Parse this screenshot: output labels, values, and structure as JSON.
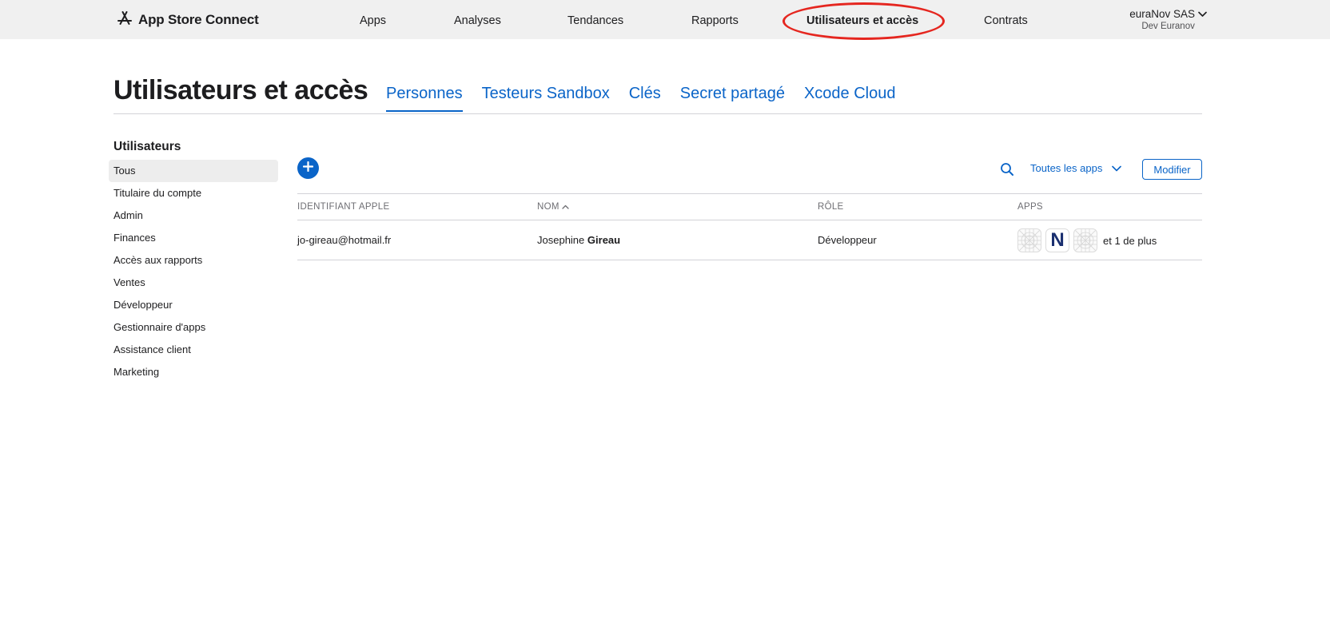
{
  "topbar": {
    "brand": "App Store Connect",
    "nav": [
      {
        "label": "Apps"
      },
      {
        "label": "Analyses"
      },
      {
        "label": "Tendances"
      },
      {
        "label": "Rapports"
      },
      {
        "label": "Utilisateurs et accès",
        "active": true
      },
      {
        "label": "Contrats"
      }
    ],
    "account": {
      "name": "euraNov SAS",
      "team": "Dev Euranov"
    }
  },
  "page": {
    "title": "Utilisateurs et accès",
    "tabs": [
      {
        "label": "Personnes",
        "active": true
      },
      {
        "label": "Testeurs Sandbox"
      },
      {
        "label": "Clés"
      },
      {
        "label": "Secret partagé"
      },
      {
        "label": "Xcode Cloud"
      }
    ]
  },
  "sidebar": {
    "heading": "Utilisateurs",
    "items": [
      {
        "label": "Tous",
        "active": true
      },
      {
        "label": "Titulaire du compte"
      },
      {
        "label": "Admin"
      },
      {
        "label": "Finances"
      },
      {
        "label": "Accès aux rapports"
      },
      {
        "label": "Ventes"
      },
      {
        "label": "Développeur"
      },
      {
        "label": "Gestionnaire d'apps"
      },
      {
        "label": "Assistance client"
      },
      {
        "label": "Marketing"
      }
    ]
  },
  "toolbar": {
    "app_filter_label": "Toutes les apps",
    "modify_label": "Modifier"
  },
  "table": {
    "columns": [
      "IDENTIFIANT APPLE",
      "NOM",
      "RÔLE",
      "APPS"
    ],
    "rows": [
      {
        "apple_id": "jo-gireau@hotmail.fr",
        "first_name": "Josephine",
        "last_name": "Gireau",
        "role": "Développeur",
        "app_icon_letter": "N",
        "more_apps": "et 1 de plus"
      }
    ]
  },
  "colors": {
    "accent": "#0a64c8",
    "highlight": "#e5261f",
    "topbar_bg": "#f0f0f0"
  },
  "icons": {
    "brand": "app-store-icon",
    "add": "plus-icon",
    "search": "search-icon",
    "filter": "chevron-down-icon",
    "sort": "chevron-up-icon",
    "app_placeholder": "app-placeholder-icon"
  }
}
